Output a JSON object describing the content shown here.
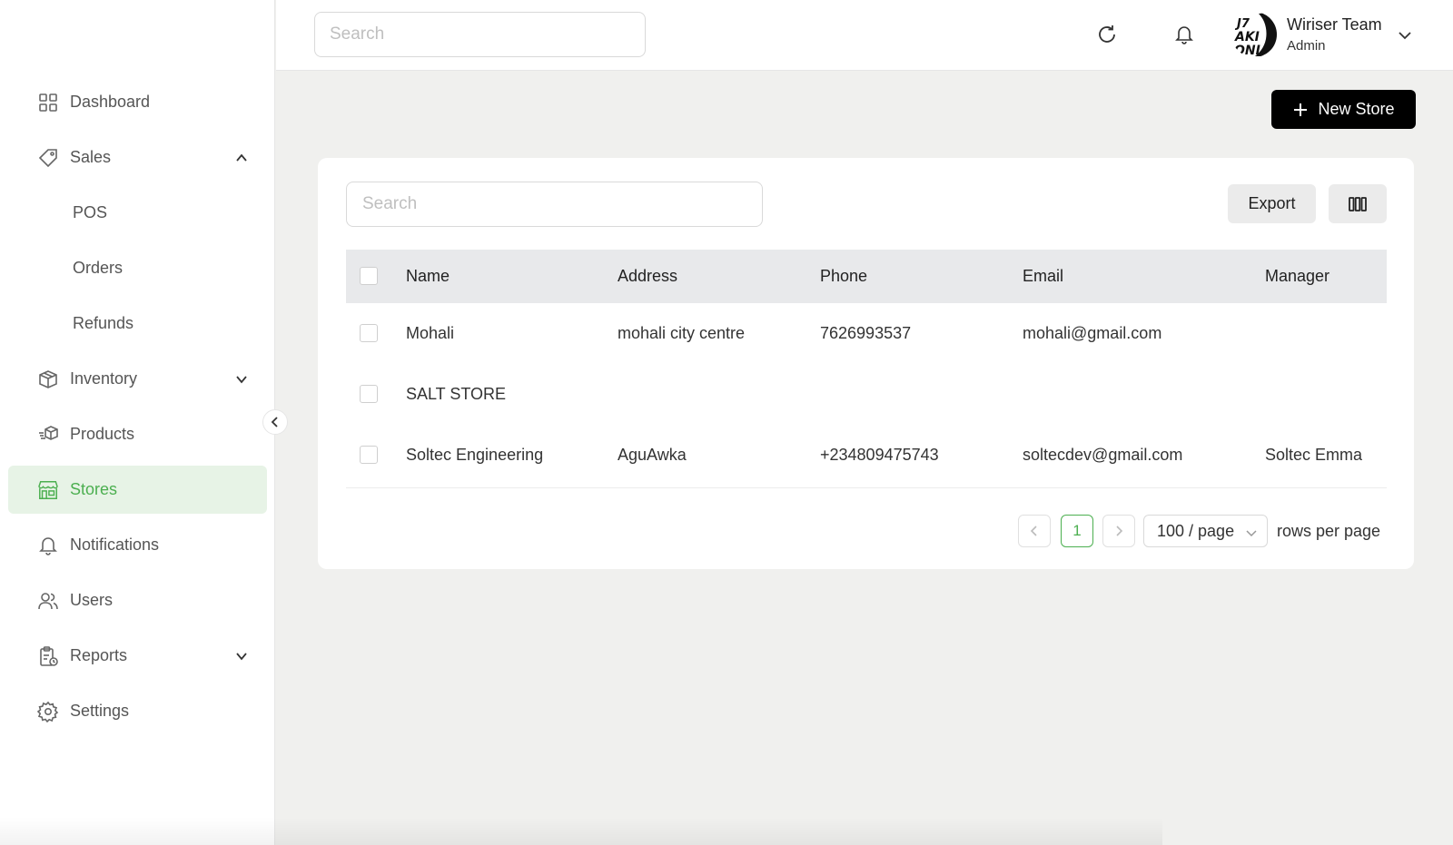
{
  "sidebar": {
    "items": [
      {
        "label": "Dashboard",
        "icon": "dashboard-grid-icon"
      },
      {
        "label": "Sales",
        "icon": "tag-icon",
        "expanded": true
      },
      {
        "label": "POS"
      },
      {
        "label": "Orders"
      },
      {
        "label": "Refunds"
      },
      {
        "label": "Inventory",
        "icon": "box-icon",
        "expanded": false
      },
      {
        "label": "Products",
        "icon": "products-icon"
      },
      {
        "label": "Stores",
        "icon": "store-icon",
        "active": true
      },
      {
        "label": "Notifications",
        "icon": "bell-icon"
      },
      {
        "label": "Users",
        "icon": "users-icon"
      },
      {
        "label": "Reports",
        "icon": "clipboard-icon",
        "expanded": false
      },
      {
        "label": "Settings",
        "icon": "gear-icon"
      }
    ]
  },
  "header": {
    "search_placeholder": "Search",
    "user": {
      "name": "Wiriser Team",
      "role": "Admin"
    }
  },
  "main": {
    "new_store_label": "New Store",
    "search_placeholder": "Search",
    "export_label": "Export",
    "table": {
      "columns": [
        "Name",
        "Address",
        "Phone",
        "Email",
        "Manager"
      ],
      "rows": [
        {
          "name": "Mohali",
          "address": "mohali city centre",
          "phone": "7626993537",
          "email": "mohali@gmail.com",
          "manager": ""
        },
        {
          "name": "SALT STORE",
          "address": "",
          "phone": "",
          "email": "",
          "manager": ""
        },
        {
          "name": "Soltec Engineering",
          "address": "AguAwka",
          "phone": "+234809475743",
          "email": "soltecdev@gmail.com",
          "manager": "Soltec Emma"
        }
      ]
    },
    "pagination": {
      "current_page": "1",
      "page_size": "100 / page",
      "rows_label": "rows per page"
    }
  },
  "colors": {
    "accent": "#4caf50",
    "active_bg": "#e7f3e6",
    "primary_button": "#000000",
    "page_bg": "#f0f0ee"
  }
}
